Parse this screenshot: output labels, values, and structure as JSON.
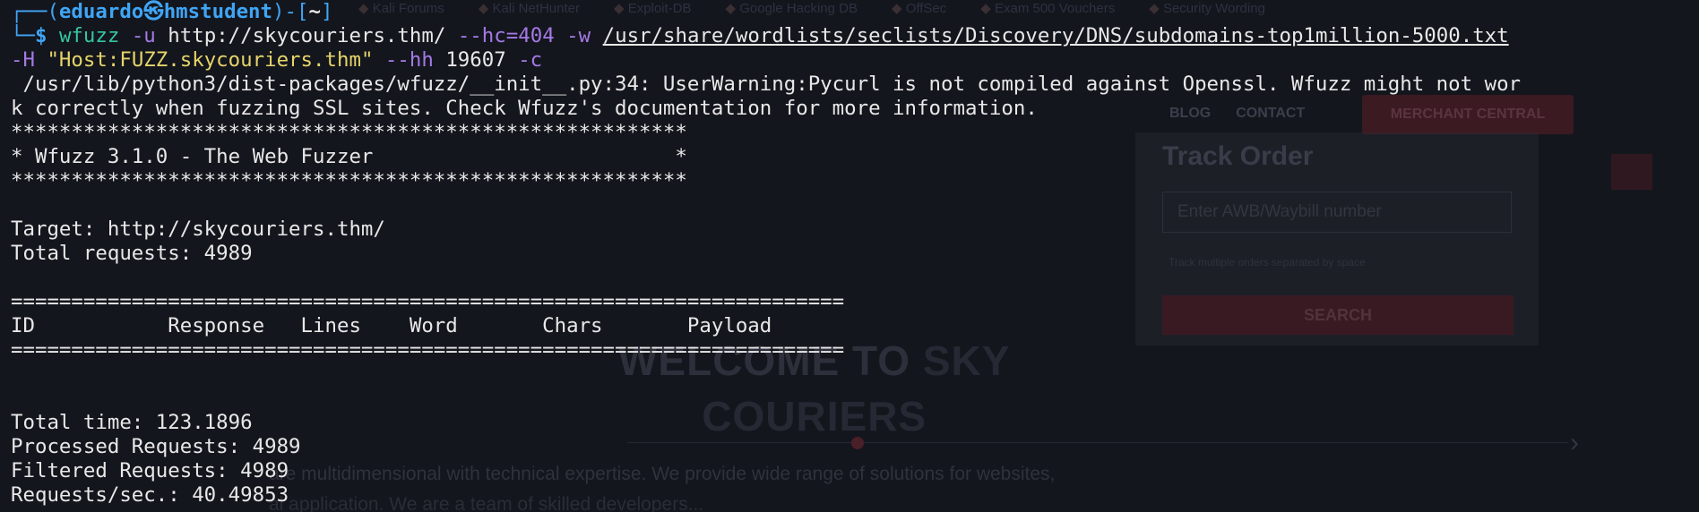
{
  "background_page": {
    "bookmarks": [
      "Kali Forums",
      "Kali NetHunter",
      "Exploit-DB",
      "Google Hacking DB",
      "OffSec",
      "Exam 500 Vouchers",
      "Security Wording"
    ],
    "nav": {
      "blog": "BLOG",
      "contact": "CONTACT",
      "merchant": "MERCHANT CENTRAL"
    },
    "track": {
      "title": "Track Order",
      "input_placeholder": "Enter AWB/Waybill number",
      "hint": "Track multiple orders separated by space",
      "search_label": "SEARCH"
    },
    "hero": {
      "line1_a": "WELCOME TO",
      "line1_b": "SKY",
      "line2": "COURIERS"
    },
    "paragraph1": "are multidimensional with technical expertise. We provide wide range of solutions for websites,",
    "paragraph2": "al application. We are a team of skilled developers..."
  },
  "terminal": {
    "prompt": {
      "corner_top": "┌──(",
      "user": "eduardo",
      "at_symbol": "㉿",
      "host": "hmstudent",
      "bracket_mid": ")-[",
      "cwd": "~",
      "bracket_end": "]",
      "corner_bottom": "└─",
      "dollar": "$"
    },
    "command": {
      "program": "wfuzz",
      "opt_u": "-u",
      "url": "http://skycouriers.thm/",
      "opt_hc": "--hc=404",
      "opt_w": "-w",
      "wordlist": "/usr/share/wordlists/seclists/Discovery/DNS/subdomains-top1million-5000.txt",
      "opt_H": "-H",
      "header": "\"Host:FUZZ.skycouriers.thm\"",
      "opt_hh": "--hh",
      "hh_value": "19607",
      "opt_c": "-c"
    },
    "warning_line1": " /usr/lib/python3/dist-packages/wfuzz/__init__.py:34: UserWarning:Pycurl is not compiled against Openssl. Wfuzz might not wor",
    "warning_line2": "k correctly when fuzzing SSL sites. Check Wfuzz's documentation for more information.",
    "banner_border": "********************************************************",
    "banner_text": "* Wfuzz 3.1.0 - The Web Fuzzer                         *",
    "target_line": "Target: http://skycouriers.thm/",
    "total_requests_line": "Total requests: 4989",
    "table_border": "=====================================================================",
    "table_header": "ID           Response   Lines    Word       Chars       Payload",
    "total_time_line": "Total time: 123.1896",
    "processed_line": "Processed Requests: 4989",
    "filtered_line": "Filtered Requests: 4989",
    "rps_line": "Requests/sec.: 40.49853"
  }
}
